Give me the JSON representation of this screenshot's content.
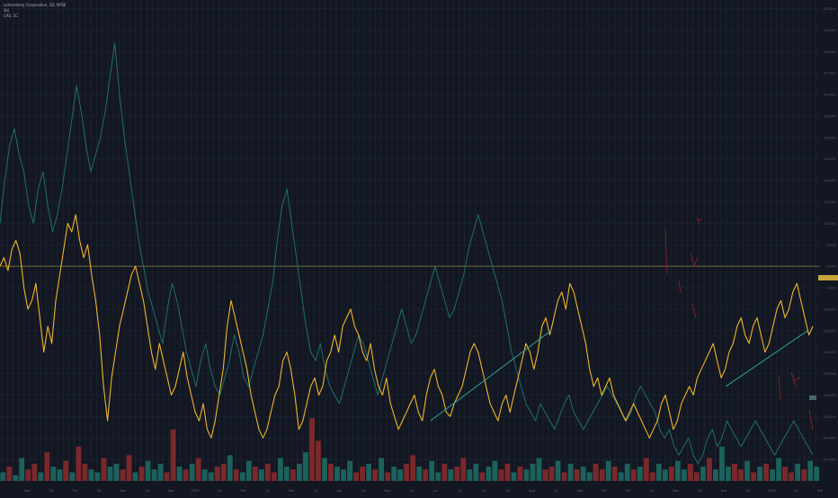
{
  "legend": {
    "symbol_line": "Lemonlemy Corporation, 1D, NYSE",
    "indicator_line_1": "Vol",
    "indicator_line_2": "CAS, 1C"
  },
  "colors": {
    "background": "#131722",
    "grid": "#1f2a3a",
    "primary_line": "#f0b429",
    "secondary_line": "#1f6f68",
    "trendline": "#2aa39a",
    "horizontal_level": "#8a8440",
    "volume_up": "#1d6f66",
    "volume_down": "#8e2b2b",
    "annotation": "#b0282a",
    "axis_text": "#5d6273"
  },
  "chart_data": {
    "type": "line",
    "title": "",
    "xlabel": "",
    "ylabel": "",
    "x_ticks": [
      "Sep",
      "16",
      "Oct",
      "16",
      "Nov",
      "16",
      "Dec",
      "2022",
      "16",
      "Feb",
      "14",
      "Mar",
      "14",
      "Apr",
      "16",
      "May",
      "16",
      "Jun",
      "13",
      "Jul",
      "16",
      "Aug",
      "15",
      "Sep",
      "16",
      "Oct",
      "16",
      "Nov",
      "16",
      "Dec",
      "16",
      "2023",
      "16",
      "Feb"
    ],
    "y_ticks": [
      "60.00%",
      "55.00%",
      "50.00%",
      "45.00%",
      "40.00%",
      "35.00%",
      "30.00%",
      "25.00%",
      "20.00%",
      "15.00%",
      "10.00%",
      "5.00%",
      "0.00%",
      "-5.00%",
      "-10.00%",
      "-15.00%",
      "-20.00%",
      "-25.00%",
      "-30.00%",
      "-35.00%",
      "-40.00%",
      "-45.00%"
    ],
    "ylim": [
      -50,
      62
    ],
    "horizontal_level": 0,
    "series": [
      {
        "role": "primary",
        "values": [
          0,
          2,
          -1,
          4,
          6,
          3,
          -5,
          -10,
          -8,
          -4,
          -12,
          -20,
          -14,
          -18,
          -8,
          -2,
          4,
          10,
          8,
          12,
          6,
          2,
          5,
          -2,
          -8,
          -16,
          -28,
          -36,
          -26,
          -20,
          -14,
          -10,
          -6,
          -2,
          0,
          -4,
          -8,
          -14,
          -20,
          -24,
          -18,
          -22,
          -26,
          -30,
          -28,
          -24,
          -20,
          -26,
          -30,
          -34,
          -36,
          -32,
          -38,
          -40,
          -36,
          -30,
          -24,
          -14,
          -8,
          -12,
          -16,
          -20,
          -24,
          -30,
          -34,
          -38,
          -40,
          -38,
          -34,
          -30,
          -28,
          -22,
          -20,
          -24,
          -30,
          -38,
          -36,
          -32,
          -28,
          -26,
          -30,
          -28,
          -22,
          -20,
          -16,
          -20,
          -14,
          -12,
          -10,
          -14,
          -16,
          -20,
          -22,
          -18,
          -24,
          -28,
          -30,
          -26,
          -32,
          -35,
          -38,
          -36,
          -34,
          -32,
          -30,
          -34,
          -36,
          -30,
          -26,
          -24,
          -28,
          -30,
          -34,
          -35,
          -32,
          -30,
          -28,
          -24,
          -20,
          -18,
          -20,
          -24,
          -28,
          -32,
          -34,
          -36,
          -32,
          -30,
          -34,
          -30,
          -26,
          -22,
          -18,
          -20,
          -24,
          -20,
          -14,
          -12,
          -16,
          -12,
          -8,
          -6,
          -10,
          -4,
          -6,
          -10,
          -14,
          -18,
          -24,
          -28,
          -26,
          -30,
          -28,
          -26,
          -30,
          -32,
          -34,
          -36,
          -34,
          -32,
          -34,
          -36,
          -38,
          -40,
          -38,
          -36,
          -32,
          -30,
          -34,
          -38,
          -36,
          -32,
          -30,
          -28,
          -30,
          -26,
          -24,
          -22,
          -20,
          -18,
          -22,
          -26,
          -24,
          -20,
          -18,
          -14,
          -12,
          -16,
          -18,
          -14,
          -12,
          -16,
          -20,
          -18,
          -14,
          -10,
          -8,
          -12,
          -10,
          -6,
          -4,
          -8,
          -12,
          -16,
          -14
        ]
      },
      {
        "role": "secondary",
        "values": [
          10,
          20,
          28,
          32,
          26,
          22,
          14,
          10,
          18,
          22,
          14,
          8,
          12,
          18,
          26,
          34,
          42,
          36,
          28,
          22,
          26,
          30,
          36,
          44,
          52,
          40,
          30,
          22,
          14,
          6,
          0,
          -6,
          -10,
          -14,
          -18,
          -10,
          -4,
          -8,
          -14,
          -20,
          -24,
          -28,
          -22,
          -18,
          -24,
          -28,
          -30,
          -26,
          -22,
          -16,
          -20,
          -26,
          -28,
          -24,
          -20,
          -16,
          -10,
          -4,
          6,
          14,
          18,
          10,
          2,
          -6,
          -14,
          -20,
          -22,
          -18,
          -24,
          -28,
          -30,
          -32,
          -28,
          -24,
          -20,
          -16,
          -18,
          -22,
          -26,
          -30,
          -26,
          -22,
          -18,
          -14,
          -10,
          -14,
          -18,
          -16,
          -12,
          -8,
          -4,
          0,
          -4,
          -8,
          -12,
          -10,
          -6,
          -2,
          4,
          8,
          12,
          8,
          4,
          0,
          -4,
          -8,
          -14,
          -20,
          -24,
          -28,
          -32,
          -34,
          -36,
          -32,
          -34,
          -36,
          -38,
          -35,
          -32,
          -30,
          -34,
          -36,
          -38,
          -36,
          -34,
          -32,
          -30,
          -28,
          -30,
          -32,
          -34,
          -36,
          -34,
          -30,
          -28,
          -30,
          -32,
          -34,
          -38,
          -40,
          -38,
          -42,
          -44,
          -42,
          -40,
          -44,
          -46,
          -44,
          -40,
          -38,
          -42,
          -40,
          -36,
          -38,
          -40,
          -42,
          -40,
          -38,
          -36,
          -38,
          -40,
          -42,
          -44,
          -42,
          -40,
          -38,
          -36,
          -38,
          -40,
          -42,
          -44
        ]
      }
    ],
    "trendlines": [
      {
        "from": [
          0.525,
          -36
        ],
        "to": [
          0.672,
          -15
        ]
      },
      {
        "from": [
          0.885,
          -28
        ],
        "to": [
          0.985,
          -15
        ]
      }
    ],
    "volume": {
      "up_down_pattern": [
        1,
        0,
        1,
        1,
        0,
        0,
        1,
        0,
        1,
        1,
        0,
        1,
        0,
        0,
        1,
        1,
        0,
        1,
        1,
        0,
        0,
        1,
        0,
        1,
        1,
        1,
        0,
        0,
        1,
        0
      ],
      "values": [
        3,
        5,
        2,
        8,
        4,
        6,
        3,
        10,
        5,
        4,
        7,
        3,
        12,
        6,
        4,
        3,
        8,
        5,
        6,
        4,
        9,
        3,
        5,
        7,
        4,
        6,
        3,
        18,
        5,
        4,
        6,
        8,
        4,
        3,
        5,
        6,
        9,
        4,
        3,
        7,
        5,
        4,
        6,
        3,
        8,
        5,
        4,
        6,
        10,
        22,
        14,
        8,
        6,
        5,
        4,
        7,
        3,
        5,
        6,
        4,
        8,
        3,
        5,
        4,
        6,
        9,
        5,
        4,
        7,
        3,
        6,
        4,
        5,
        8,
        4,
        6,
        3,
        5,
        7,
        4,
        6,
        3,
        5,
        4,
        6,
        8,
        4,
        5,
        7,
        3,
        6,
        4,
        5,
        3,
        6,
        4,
        7,
        5,
        3,
        6,
        4,
        5,
        8,
        3,
        6,
        4,
        5,
        7,
        4,
        6,
        3,
        5,
        8,
        4,
        12,
        5,
        6,
        4,
        7,
        3,
        5,
        6,
        4,
        8,
        5,
        3,
        6,
        4,
        7,
        5
      ]
    }
  }
}
